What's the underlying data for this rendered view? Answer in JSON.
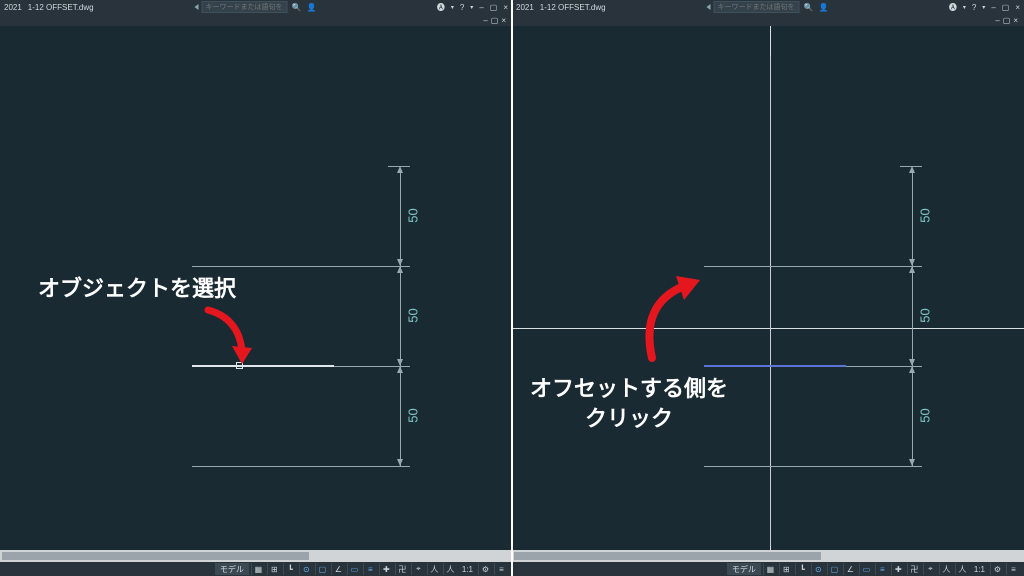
{
  "app": {
    "year": "2021",
    "filename": "1-12 OFFSET.dwg"
  },
  "search": {
    "placeholder": "キーワードまたは語句を入力"
  },
  "header": {
    "help": "?",
    "minus": "–",
    "square": "▢",
    "close": "×",
    "subA": "–",
    "subB": "▢",
    "subC": "×",
    "shareA": "🅐",
    "dot": "▾",
    "account": "👤"
  },
  "dims": {
    "d1": "50",
    "d2": "50",
    "d3": "50"
  },
  "anno": {
    "left": "オブジェクトを選択",
    "right": "オフセットする側を\nクリック"
  },
  "status": {
    "model": "モデル",
    "grid": "▦",
    "snap": "⊞",
    "ortho": "┗",
    "polar": "⊙",
    "osnap": "▢",
    "otrack": "∠",
    "dyn": "▭",
    "lwt": "≡",
    "a1": "✚",
    "a2": "卍",
    "a3": "⌖",
    "a4": "▦",
    "人": "人",
    "scale": "1:1",
    "gear": "⚙",
    "menu": "≡"
  }
}
